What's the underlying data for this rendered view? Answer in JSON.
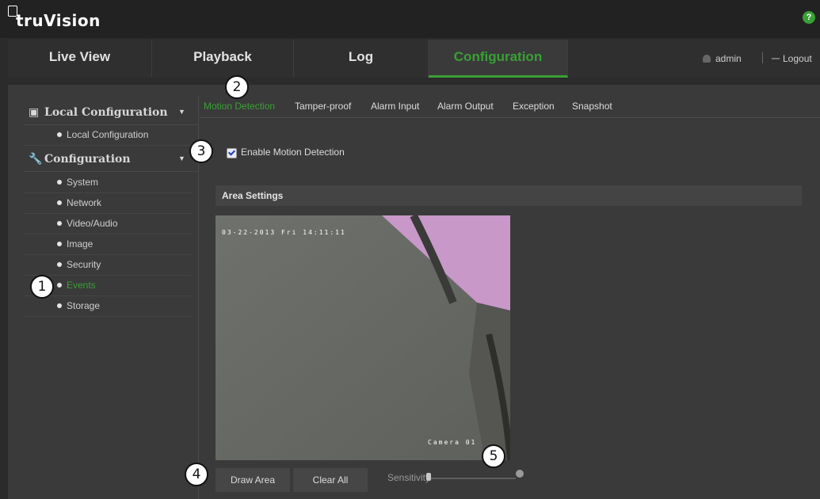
{
  "app": {
    "logo_text": "truVision",
    "help_label": "?"
  },
  "nav": {
    "tabs": [
      {
        "label": "Live View"
      },
      {
        "label": "Playback"
      },
      {
        "label": "Log"
      },
      {
        "label": "Configuration"
      }
    ],
    "active_tab": "Configuration",
    "user": "admin",
    "logout": "Logout"
  },
  "sidebar": {
    "local": {
      "title": "Local Configuration",
      "items": [
        {
          "label": "Local Configuration"
        }
      ]
    },
    "config": {
      "title": "Configuration",
      "items": [
        {
          "label": "System"
        },
        {
          "label": "Network"
        },
        {
          "label": "Video/Audio"
        },
        {
          "label": "Image"
        },
        {
          "label": "Security"
        },
        {
          "label": "Events"
        },
        {
          "label": "Storage"
        }
      ]
    },
    "active_item": "Events"
  },
  "subtabs": [
    {
      "label": "Motion Detection"
    },
    {
      "label": "Tamper-proof"
    },
    {
      "label": "Alarm Input"
    },
    {
      "label": "Alarm Output"
    },
    {
      "label": "Exception"
    },
    {
      "label": "Snapshot"
    }
  ],
  "active_subtab": "Motion Detection",
  "enable": {
    "label": "Enable Motion Detection",
    "checked": true
  },
  "area": {
    "title": "Area Settings",
    "osd_datetime": "03-22-2013 Fri 14:11:11",
    "osd_camera": "Camera 01"
  },
  "controls": {
    "draw_area": "Draw Area",
    "clear_all": "Clear All",
    "sensitivity_label": "Sensitivity",
    "sensitivity_value": 0
  },
  "callouts": [
    "1",
    "2",
    "3",
    "4",
    "5"
  ],
  "colors": {
    "accent": "#39a035",
    "background": "#3a3a3a",
    "header": "#222222"
  }
}
